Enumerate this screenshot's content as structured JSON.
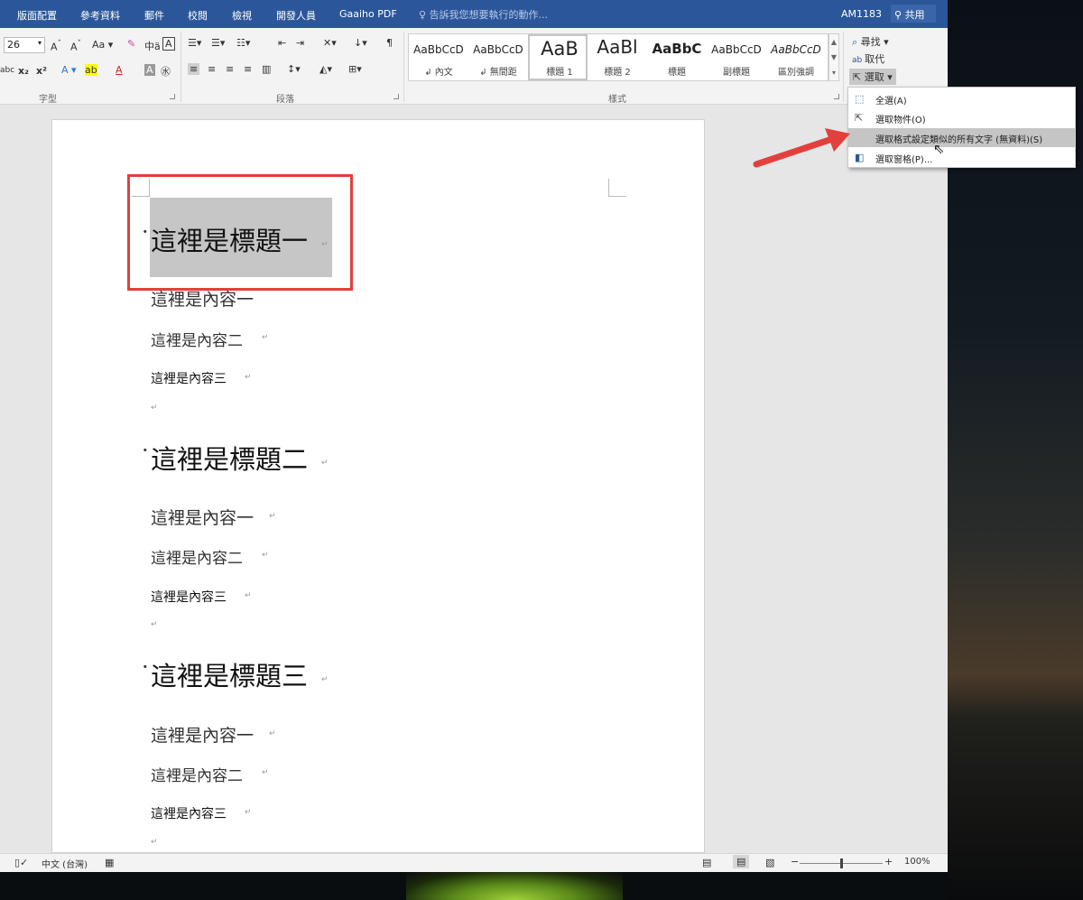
{
  "ribbon_tabs": [
    "版面配置",
    "參考資料",
    "郵件",
    "校閱",
    "檢視",
    "開發人員",
    "Gaaiho PDF"
  ],
  "tell_me": "告訴我您想要執行的動作...",
  "user": "AM1183",
  "share": "共用",
  "font": {
    "size": "26",
    "group_label": "字型"
  },
  "paragraph_group_label": "段落",
  "styles_group_label": "樣式",
  "styles": [
    {
      "preview": "AaBbCcD",
      "name": "↲ 內文"
    },
    {
      "preview": "AaBbCcD",
      "name": "↲ 無間距"
    },
    {
      "preview": "AaB",
      "name": "標題 1"
    },
    {
      "preview": "AaBl",
      "name": "標題 2"
    },
    {
      "preview": "AaBbC",
      "name": "標題"
    },
    {
      "preview": "AaBbCcD",
      "name": "副標題"
    },
    {
      "preview": "AaBbCcD",
      "name": "區別強調"
    }
  ],
  "editing": {
    "find": "尋找",
    "replace": "取代",
    "select": "選取"
  },
  "select_menu": [
    {
      "label": "全選(A)"
    },
    {
      "label": "選取物件(O)"
    },
    {
      "label": "選取格式設定類似的所有文字 (無資料)(S)"
    },
    {
      "label": "選取窗格(P)..."
    }
  ],
  "document": {
    "sections": [
      {
        "heading": "這裡是標題一",
        "items": [
          "這裡是內容一",
          "這裡是內容二",
          "這裡是內容三"
        ]
      },
      {
        "heading": "這裡是標題二",
        "items": [
          "這裡是內容一",
          "這裡是內容二",
          "這裡是內容三"
        ]
      },
      {
        "heading": "這裡是標題三",
        "items": [
          "這裡是內容一",
          "這裡是內容二",
          "這裡是內容三"
        ]
      }
    ]
  },
  "status": {
    "language": "中文 (台灣)",
    "zoom": "100%",
    "zoom_fraction": 0.5
  },
  "colors": {
    "ribbon_blue": "#2b579a",
    "highlight_red": "#e2403c",
    "selection_gray": "#c6c6c6"
  }
}
